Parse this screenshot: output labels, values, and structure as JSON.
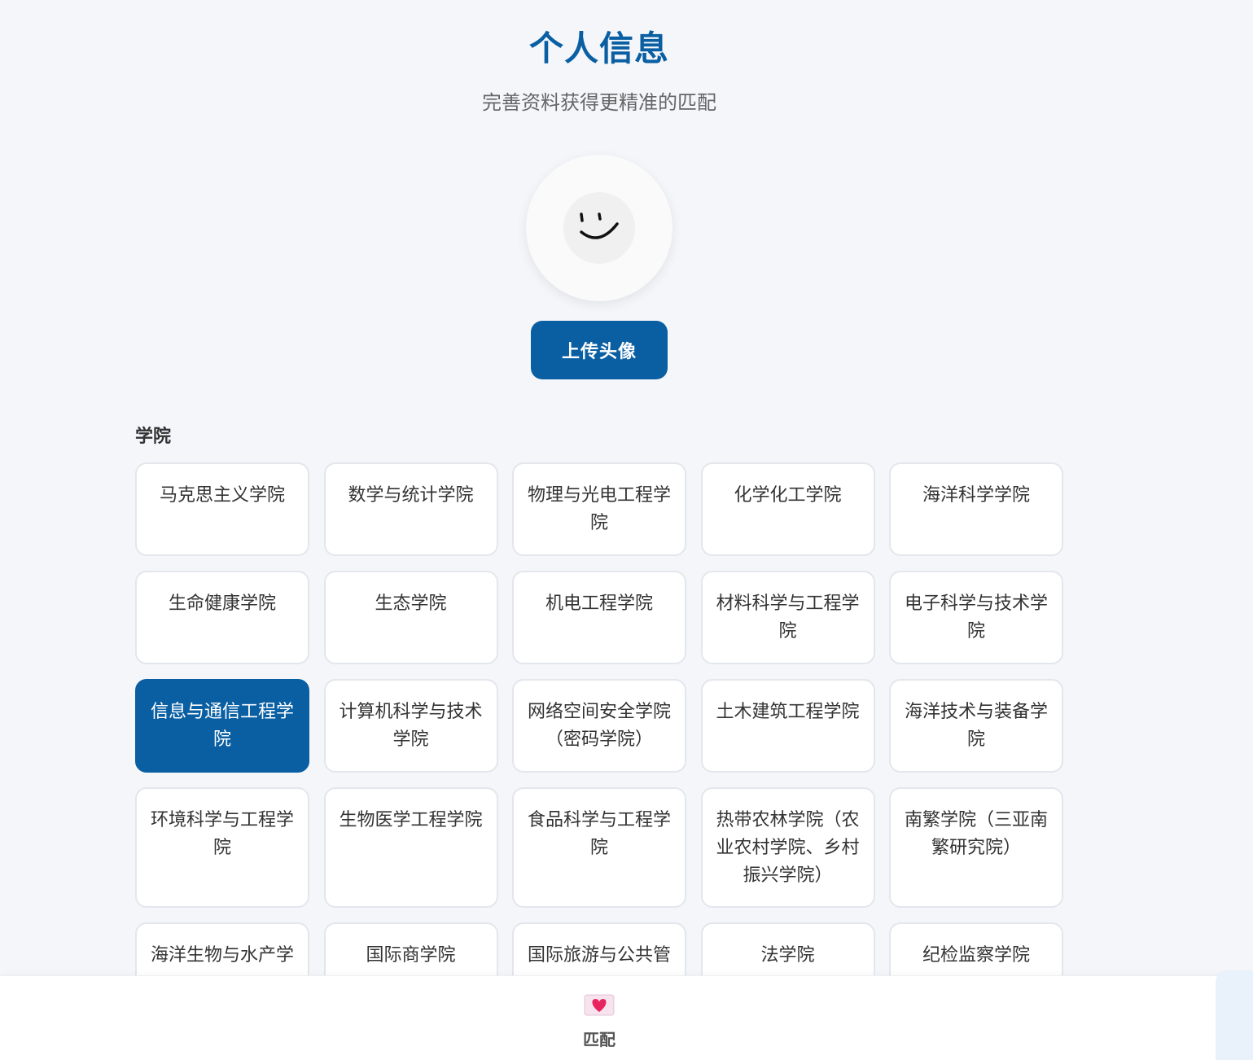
{
  "header": {
    "title": "个人信息",
    "subtitle": "完善资料获得更精准的匹配"
  },
  "avatar": {
    "icon": "smiley-face-icon",
    "upload_label": "上传头像"
  },
  "college_section": {
    "label": "学院",
    "selected": "信息与通信工程学院",
    "options": [
      "马克思主义学院",
      "数学与统计学院",
      "物理与光电工程学院",
      "化学化工学院",
      "海洋科学学院",
      "生命健康学院",
      "生态学院",
      "机电工程学院",
      "材料科学与工程学院",
      "电子科学与技术学院",
      "信息与通信工程学院",
      "计算机科学与技术学院",
      "网络空间安全学院（密码学院）",
      "土木建筑工程学院",
      "海洋技术与装备学院",
      "环境科学与工程学院",
      "生物医学工程学院",
      "食品科学与工程学院",
      "热带农林学院（农业农村学院、乡村振兴学院）",
      "南繁学院（三亚南繁研究院）",
      "海洋生物与水产学",
      "国际商学院",
      "国际旅游与公共管",
      "法学院",
      "纪检监察学院"
    ]
  },
  "bottom_nav": {
    "match_label": "匹配",
    "match_icon": "heart-envelope-icon"
  },
  "colors": {
    "primary": "#0a5fa3",
    "background": "#f4f6fa"
  }
}
